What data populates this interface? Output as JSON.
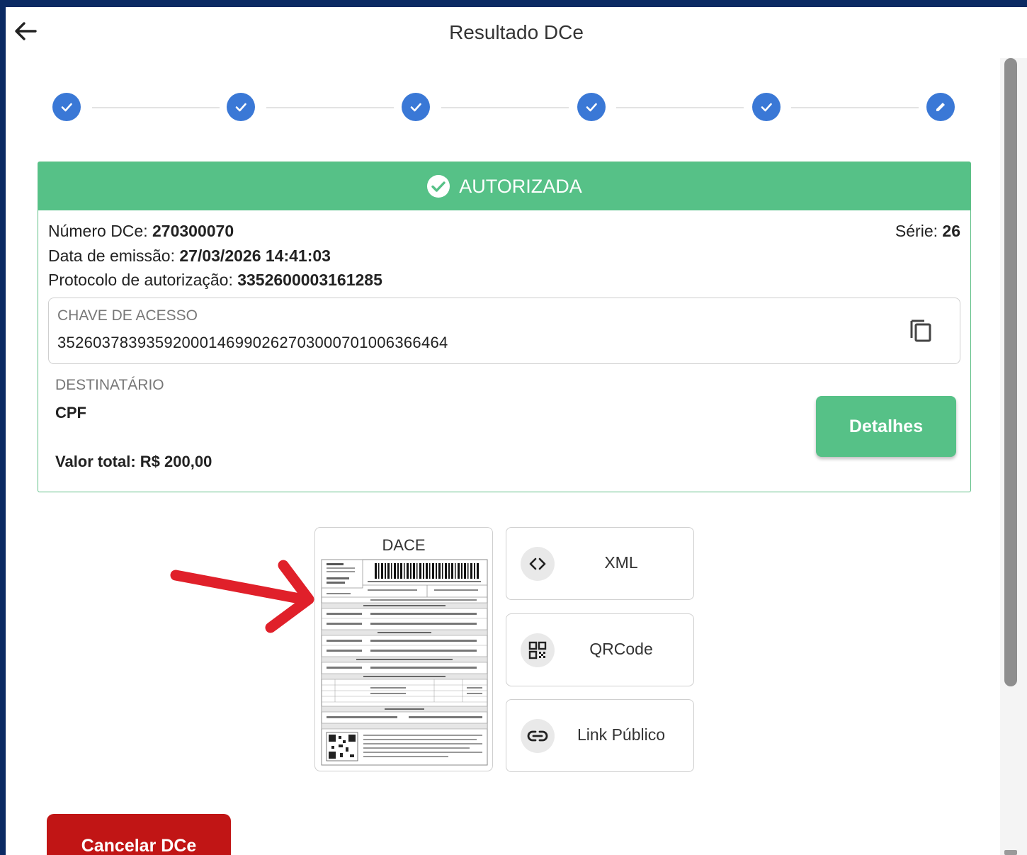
{
  "header": {
    "title": "Resultado DCe"
  },
  "stepper": {
    "steps": [
      {
        "state": "done"
      },
      {
        "state": "done"
      },
      {
        "state": "done"
      },
      {
        "state": "done"
      },
      {
        "state": "done"
      },
      {
        "state": "editing"
      }
    ]
  },
  "status": {
    "label": "AUTORIZADA",
    "color": "#56c187"
  },
  "info": {
    "numero_label": "Número DCe: ",
    "numero_value": "270300070",
    "serie_label": "Série: ",
    "serie_value": "26",
    "data_label": "Data de emissão: ",
    "data_value": "27/03/2026 14:41:03",
    "protocolo_label": "Protocolo de autorização: ",
    "protocolo_value": "3352600003161285"
  },
  "chave": {
    "label": "CHAVE DE ACESSO",
    "value": "35260378393592000146990262703000701006366464"
  },
  "destinatario": {
    "label": "DESTINATÁRIO",
    "value": "CPF"
  },
  "valor_total": "Valor total: R$ 200,00",
  "buttons": {
    "detalhes": "Detalhes",
    "cancelar": "Cancelar DCe"
  },
  "documents": {
    "dace_title": "DACE",
    "actions": [
      {
        "label": "XML",
        "icon": "code-icon"
      },
      {
        "label": "QRCode",
        "icon": "qrcode-icon"
      },
      {
        "label": "Link Público",
        "icon": "link-icon"
      }
    ]
  },
  "colors": {
    "accent": "#3a78d6",
    "success": "#56c187",
    "danger": "#c11515",
    "annotation": "#e0202a"
  }
}
